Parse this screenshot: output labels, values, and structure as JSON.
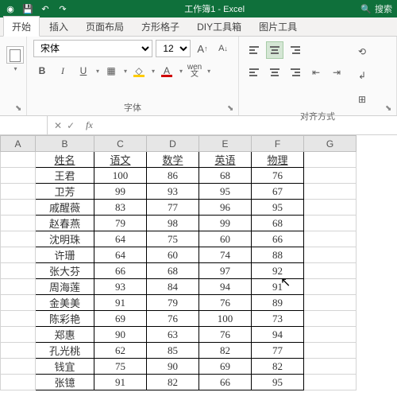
{
  "titlebar": {
    "title": "工作簿1 - Excel",
    "search": "搜索"
  },
  "tabs": [
    "开始",
    "插入",
    "页面布局",
    "方形格子",
    "DIY工具箱",
    "图片工具"
  ],
  "active_tab": 0,
  "ribbon": {
    "font_group_label": "字体",
    "align_group_label": "对齐方式",
    "font_name": "宋体",
    "font_size": "12",
    "bold": "B",
    "italic": "I",
    "underline": "U",
    "wen": "wen\n文"
  },
  "namebox": "",
  "fx_label": "fx",
  "headers": [
    "A",
    "B",
    "C",
    "D",
    "E",
    "F",
    "G"
  ],
  "chart_data": {
    "type": "table",
    "columns": [
      "姓名",
      "语文",
      "数学",
      "英语",
      "物理"
    ],
    "rows": [
      [
        "王君",
        100,
        86,
        68,
        76
      ],
      [
        "卫芳",
        99,
        93,
        95,
        67
      ],
      [
        "戚醒薇",
        83,
        77,
        96,
        95
      ],
      [
        "赵春燕",
        79,
        98,
        99,
        68
      ],
      [
        "沈明珠",
        64,
        75,
        60,
        66
      ],
      [
        "许珊",
        64,
        60,
        74,
        88
      ],
      [
        "张大芬",
        66,
        68,
        97,
        92
      ],
      [
        "周海莲",
        93,
        84,
        94,
        91
      ],
      [
        "金美美",
        91,
        79,
        76,
        89
      ],
      [
        "陈彩艳",
        69,
        76,
        100,
        73
      ],
      [
        "郑惠",
        90,
        63,
        76,
        94
      ],
      [
        "孔光桃",
        62,
        85,
        82,
        77
      ],
      [
        "钱宜",
        75,
        90,
        69,
        82
      ],
      [
        "张镱",
        91,
        82,
        66,
        95
      ]
    ]
  }
}
